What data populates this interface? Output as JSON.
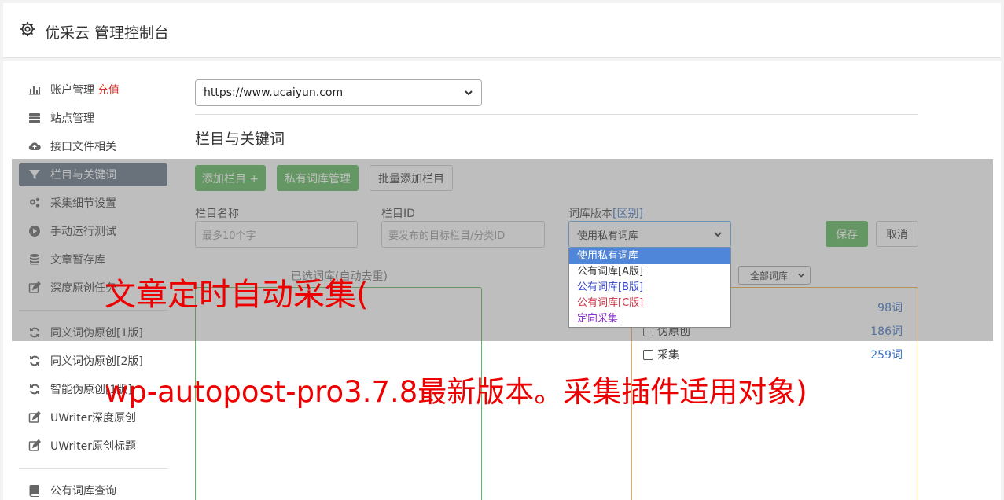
{
  "header": {
    "title": "优采云 管理控制台"
  },
  "sidebar": {
    "items": [
      {
        "label": "账户管理",
        "extra": "充值",
        "icon": "bar-chart-icon"
      },
      {
        "label": "站点管理",
        "icon": "server-icon"
      },
      {
        "label": "接口文件相关",
        "icon": "cloud-upload-icon"
      },
      {
        "label": "栏目与关键词",
        "icon": "filter-icon",
        "active": true
      },
      {
        "label": "采集细节设置",
        "icon": "gears-icon"
      },
      {
        "label": "手动运行测试",
        "icon": "play-circle-icon"
      },
      {
        "label": "文章暂存库",
        "icon": "database-icon"
      },
      {
        "label": "深度原创任务",
        "icon": "edit-icon"
      },
      {
        "label": "同义词伪原创[1版]",
        "icon": "refresh-icon"
      },
      {
        "label": "同义词伪原创[2版]",
        "icon": "refresh-icon"
      },
      {
        "label": "智能伪原创[1版]",
        "icon": "refresh-icon"
      },
      {
        "label": "UWriter深度原创",
        "icon": "edit-icon"
      },
      {
        "label": "UWriter原创标题",
        "icon": "edit-icon"
      },
      {
        "label": "公有词库查询",
        "icon": "book-icon"
      }
    ]
  },
  "main": {
    "site_select": "https://www.ucaiyun.com",
    "section_title": "栏目与关键词",
    "buttons": {
      "add_column": "添加栏目 +",
      "private_lib": "私有词库管理",
      "batch_add": "批量添加栏目",
      "save": "保存",
      "cancel": "取消"
    },
    "form": {
      "name_label": "栏目名称",
      "name_placeholder": "最多10个字",
      "id_label": "栏目ID",
      "id_placeholder": "要发布的目标栏目/分类ID",
      "version_label": "词库版本",
      "version_link": "[区别]",
      "version_value": "使用私有词库"
    },
    "version_options": [
      {
        "label": "使用私有词库",
        "color": "#ffffff"
      },
      {
        "label": "公有词库[A版]",
        "color": "#333333"
      },
      {
        "label": "公有词库[B版]",
        "color": "#3344cc"
      },
      {
        "label": "公有词库[C版]",
        "color": "#cc3344"
      },
      {
        "label": "定向采集",
        "color": "#8833cc"
      }
    ],
    "selected_caption": "已选词库(自动去重)",
    "library_filter": "全部词库",
    "library_rows": [
      {
        "label": "",
        "count": "98词"
      },
      {
        "label": "伪原创",
        "count": "186词"
      },
      {
        "label": "采集",
        "count": "259词"
      }
    ]
  },
  "overlay_text": {
    "line1": "文章定时自动采集(",
    "line2": "wp-autopost-pro3.7.8最新版本。采集插件适用对象)"
  }
}
